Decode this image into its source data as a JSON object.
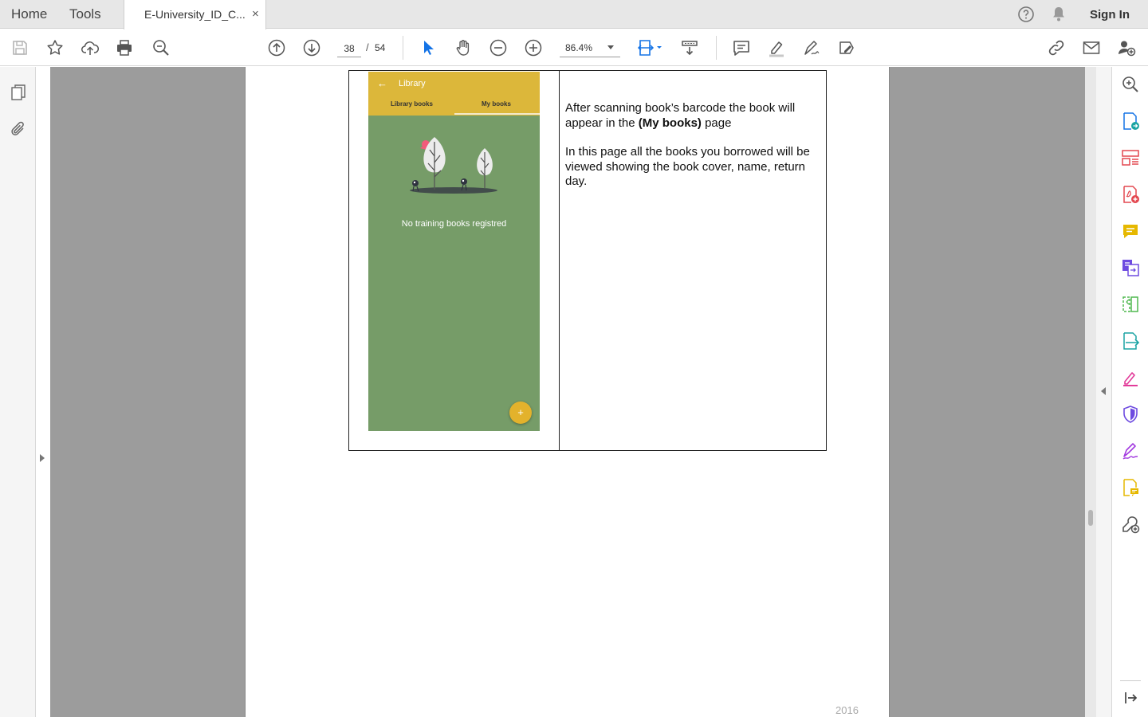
{
  "menubar": {
    "home_label": "Home",
    "tools_label": "Tools",
    "document_tab_title": "E-University_ID_C...",
    "close_symbol": "×",
    "sign_in_label": "Sign In",
    "icons": [
      "help-icon",
      "notification-bell-icon"
    ]
  },
  "toolbar": {
    "icons": [
      "save-icon",
      "bookmark-star-icon",
      "upload-cloud-icon",
      "print-icon",
      "zoom-search-icon",
      "previous-page-icon",
      "next-page-icon",
      "select-cursor-icon",
      "hand-tool-icon",
      "zoom-out-icon",
      "zoom-in-icon",
      "fit-page-icon",
      "scroll-mode-icon",
      "comment-icon",
      "highlight-icon",
      "sign-icon",
      "edit-redact-icon",
      "share-link-icon",
      "email-icon",
      "add-user-icon"
    ],
    "current_page": "38",
    "page_separator": "/",
    "total_pages": "54",
    "zoom_level": "86.4%",
    "accent_color": "#1473e6"
  },
  "left_panel": {
    "icons": [
      "page-thumbnails-icon",
      "attachments-icon",
      "expand-panel-icon"
    ]
  },
  "document": {
    "app_screenshot": {
      "back_arrow": "←",
      "title": "Library",
      "tabs": [
        "Library books",
        "My books"
      ],
      "selected_tab": "My books",
      "empty_message": "No training books registred",
      "fab_symbol": "+",
      "app_bar_color": "#dcb73a",
      "background_color": "#769c68"
    },
    "description": {
      "p1_before": "After scanning book’s barcode the book will appear in the ",
      "p1_bold": "(My books)",
      "p1_after": " page",
      "p2": "In this page all the books you borrowed will be viewed showing the book cover, name, return day."
    },
    "footer_text": "2016"
  },
  "right_panel": {
    "icons": [
      "enhance-scan-icon",
      "export-pdf-icon",
      "organize-pages-icon",
      "create-pdf-icon",
      "comment-tool-icon",
      "combine-files-icon",
      "compare-files-icon",
      "send-for-review-icon",
      "fill-sign-icon",
      "protect-shield-icon",
      "certificates-icon",
      "send-comments-icon",
      "more-tools-icon",
      "collapse-panel-icon"
    ],
    "colors": {
      "blue": "#1473e6",
      "red": "#e34850",
      "yellow": "#e6b800",
      "purple": "#6e4be0",
      "green": "#4fb84f",
      "teal": "#1aa3a3",
      "pink": "#e23c9a",
      "violet": "#a33be0"
    }
  }
}
